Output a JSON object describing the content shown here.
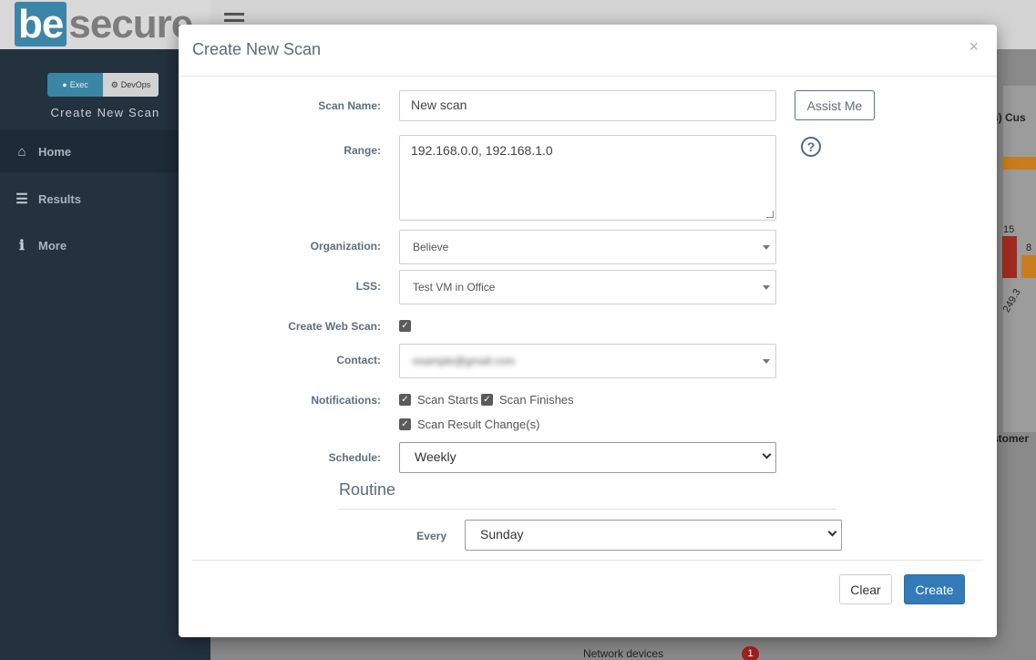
{
  "app": {
    "logo": {
      "prefix": "be",
      "rest": "secure"
    },
    "mode_toggle": {
      "exec": "Exec",
      "devops": "DevOps"
    },
    "sidebar_subtitle": "Create New Scan",
    "nav": [
      {
        "label": "Home",
        "icon": "home-icon"
      },
      {
        "label": "Results",
        "icon": "list-icon"
      },
      {
        "label": "More",
        "icon": "info-icon"
      }
    ],
    "background": {
      "chart_title_fragment": "(s) Cus",
      "customer_fragment": "stomer",
      "bar_labels": [
        "15",
        "8"
      ],
      "ip_fragment": "249.3",
      "network_devices": {
        "label": "Network devices",
        "count": "1"
      }
    }
  },
  "modal": {
    "title": "Create New Scan",
    "close": "×",
    "scan_name": {
      "label": "Scan Name:",
      "value": "New scan"
    },
    "assist_button": "Assist Me",
    "range": {
      "label": "Range:",
      "value": "192.168.0.0, 192.168.1.0"
    },
    "help_icon": "?",
    "organization": {
      "label": "Organization:",
      "value": "Believe"
    },
    "lss": {
      "label": "LSS:",
      "value": "Test VM in Office"
    },
    "create_web_scan": {
      "label": "Create Web Scan:",
      "checked": true
    },
    "contact": {
      "label": "Contact:",
      "value": "example@gmail.com"
    },
    "notifications": {
      "label": "Notifications:",
      "options": [
        {
          "label": "Scan Starts",
          "checked": true
        },
        {
          "label": "Scan Finishes",
          "checked": true
        },
        {
          "label": "Scan Result Change(s)",
          "checked": true
        }
      ]
    },
    "schedule": {
      "label": "Schedule:",
      "value": "Weekly"
    },
    "routine": {
      "title": "Routine",
      "every": {
        "label": "Every",
        "value": "Sunday"
      }
    },
    "buttons": {
      "clear": "Clear",
      "create": "Create"
    }
  }
}
